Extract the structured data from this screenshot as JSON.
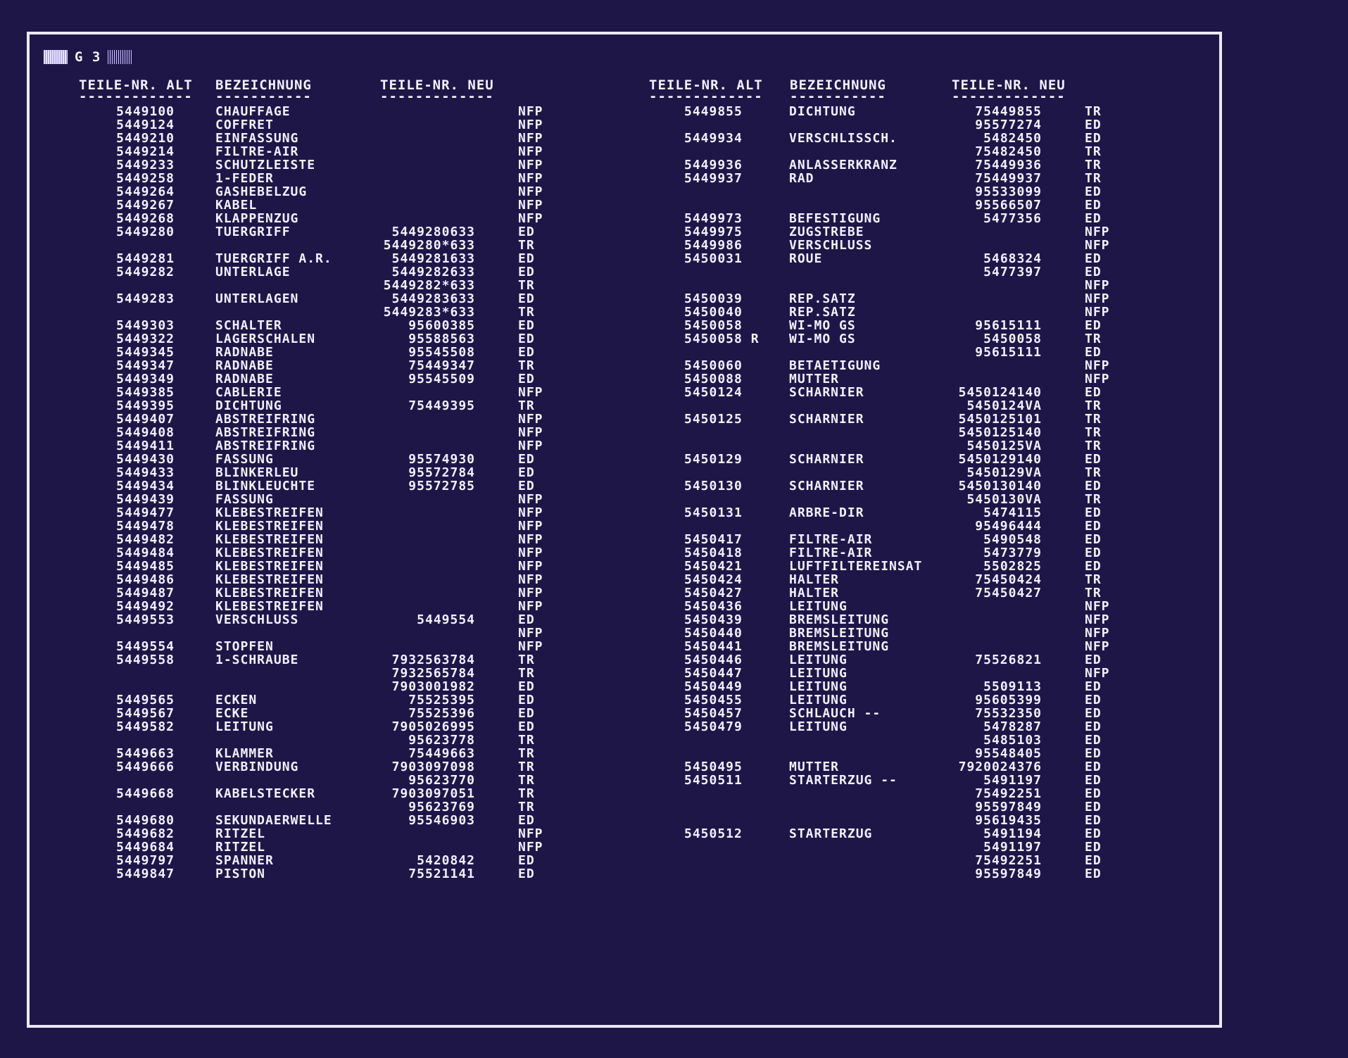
{
  "page": {
    "code": "G 3"
  },
  "headers": {
    "old": "TEILE-NR. ALT",
    "desc": "BEZEICHNUNG",
    "new": "TEILE-NR. NEU",
    "rule_old": "-------------",
    "rule_desc": "-----------",
    "rule_new": "-------------"
  },
  "left_rows": [
    {
      "alt": "5449100",
      "bez": "CHAUFFAGE",
      "neu": "",
      "st": "NFP"
    },
    {
      "alt": "5449124",
      "bez": "COFFRET",
      "neu": "",
      "st": "NFP"
    },
    {
      "alt": "5449210",
      "bez": "EINFASSUNG",
      "neu": "",
      "st": "NFP"
    },
    {
      "alt": "5449214",
      "bez": "FILTRE-AIR",
      "neu": "",
      "st": "NFP"
    },
    {
      "alt": "5449233",
      "bez": "SCHUTZLEISTE",
      "neu": "",
      "st": "NFP"
    },
    {
      "alt": "5449258",
      "bez": "1-FEDER",
      "neu": "",
      "st": "NFP"
    },
    {
      "alt": "5449264",
      "bez": "GASHEBELZUG",
      "neu": "",
      "st": "NFP"
    },
    {
      "alt": "5449267",
      "bez": "KABEL",
      "neu": "",
      "st": "NFP"
    },
    {
      "alt": "5449268",
      "bez": "KLAPPENZUG",
      "neu": "",
      "st": "NFP"
    },
    {
      "alt": "5449280",
      "bez": "TUERGRIFF",
      "neu": "5449280633",
      "st": "ED"
    },
    {
      "alt": "",
      "bez": "",
      "neu": "5449280*633",
      "st": "TR"
    },
    {
      "alt": "5449281",
      "bez": "TUERGRIFF A.R.",
      "neu": "5449281633",
      "st": "ED"
    },
    {
      "alt": "5449282",
      "bez": "UNTERLAGE",
      "neu": "5449282633",
      "st": "ED"
    },
    {
      "alt": "",
      "bez": "",
      "neu": "5449282*633",
      "st": "TR"
    },
    {
      "alt": "5449283",
      "bez": "UNTERLAGEN",
      "neu": "5449283633",
      "st": "ED"
    },
    {
      "alt": "",
      "bez": "",
      "neu": "5449283*633",
      "st": "TR"
    },
    {
      "alt": "5449303",
      "bez": "SCHALTER",
      "neu": "95600385",
      "st": "ED"
    },
    {
      "alt": "5449322",
      "bez": "LAGERSCHALEN",
      "neu": "95588563",
      "st": "ED"
    },
    {
      "alt": "5449345",
      "bez": "RADNABE",
      "neu": "95545508",
      "st": "ED"
    },
    {
      "alt": "5449347",
      "bez": "RADNABE",
      "neu": "75449347",
      "st": "TR"
    },
    {
      "alt": "5449349",
      "bez": "RADNABE",
      "neu": "95545509",
      "st": "ED"
    },
    {
      "alt": "5449385",
      "bez": "CABLERIE",
      "neu": "",
      "st": "NFP"
    },
    {
      "alt": "5449395",
      "bez": "DICHTUNG",
      "neu": "75449395",
      "st": "TR"
    },
    {
      "alt": "5449407",
      "bez": "ABSTREIFRING",
      "neu": "",
      "st": "NFP"
    },
    {
      "alt": "5449408",
      "bez": "ABSTREIFRING",
      "neu": "",
      "st": "NFP"
    },
    {
      "alt": "5449411",
      "bez": "ABSTREIFRING",
      "neu": "",
      "st": "NFP"
    },
    {
      "alt": "5449430",
      "bez": "FASSUNG",
      "neu": "95574930",
      "st": "ED"
    },
    {
      "alt": "5449433",
      "bez": "BLINKERLEU",
      "neu": "95572784",
      "st": "ED"
    },
    {
      "alt": "5449434",
      "bez": "BLINKLEUCHTE",
      "neu": "95572785",
      "st": "ED"
    },
    {
      "alt": "5449439",
      "bez": "FASSUNG",
      "neu": "",
      "st": "NFP"
    },
    {
      "alt": "5449477",
      "bez": "KLEBESTREIFEN",
      "neu": "",
      "st": "NFP"
    },
    {
      "alt": "5449478",
      "bez": "KLEBESTREIFEN",
      "neu": "",
      "st": "NFP"
    },
    {
      "alt": "5449482",
      "bez": "KLEBESTREIFEN",
      "neu": "",
      "st": "NFP"
    },
    {
      "alt": "5449484",
      "bez": "KLEBESTREIFEN",
      "neu": "",
      "st": "NFP"
    },
    {
      "alt": "5449485",
      "bez": "KLEBESTREIFEN",
      "neu": "",
      "st": "NFP"
    },
    {
      "alt": "5449486",
      "bez": "KLEBESTREIFEN",
      "neu": "",
      "st": "NFP"
    },
    {
      "alt": "5449487",
      "bez": "KLEBESTREIFEN",
      "neu": "",
      "st": "NFP"
    },
    {
      "alt": "5449492",
      "bez": "KLEBESTREIFEN",
      "neu": "",
      "st": "NFP"
    },
    {
      "alt": "5449553",
      "bez": "VERSCHLUSS",
      "neu": "5449554",
      "st": "ED"
    },
    {
      "alt": "",
      "bez": "",
      "neu": "",
      "st": "NFP"
    },
    {
      "alt": "5449554",
      "bez": "STOPFEN",
      "neu": "",
      "st": "NFP"
    },
    {
      "alt": "5449558",
      "bez": "1-SCHRAUBE",
      "neu": "7932563784",
      "st": "TR"
    },
    {
      "alt": "",
      "bez": "",
      "neu": "7932565784",
      "st": "TR"
    },
    {
      "alt": "",
      "bez": "",
      "neu": "7903001982",
      "st": "ED"
    },
    {
      "alt": "5449565",
      "bez": "ECKEN",
      "neu": "75525395",
      "st": "ED"
    },
    {
      "alt": "5449567",
      "bez": "ECKE",
      "neu": "75525396",
      "st": "ED"
    },
    {
      "alt": "5449582",
      "bez": "LEITUNG",
      "neu": "7905026995",
      "st": "ED"
    },
    {
      "alt": "",
      "bez": "",
      "neu": "95623778",
      "st": "TR"
    },
    {
      "alt": "5449663",
      "bez": "KLAMMER",
      "neu": "75449663",
      "st": "TR"
    },
    {
      "alt": "5449666",
      "bez": "VERBINDUNG",
      "neu": "7903097098",
      "st": "TR"
    },
    {
      "alt": "",
      "bez": "",
      "neu": "95623770",
      "st": "TR"
    },
    {
      "alt": "5449668",
      "bez": "KABELSTECKER",
      "neu": "7903097051",
      "st": "TR"
    },
    {
      "alt": "",
      "bez": "",
      "neu": "95623769",
      "st": "TR"
    },
    {
      "alt": "5449680",
      "bez": "SEKUNDAERWELLE",
      "neu": "95546903",
      "st": "ED"
    },
    {
      "alt": "5449682",
      "bez": "RITZEL",
      "neu": "",
      "st": "NFP"
    },
    {
      "alt": "5449684",
      "bez": "RITZEL",
      "neu": "",
      "st": "NFP"
    },
    {
      "alt": "5449797",
      "bez": "SPANNER",
      "neu": "5420842",
      "st": "ED"
    },
    {
      "alt": "5449847",
      "bez": "PISTON",
      "neu": "75521141",
      "st": "ED"
    }
  ],
  "right_rows": [
    {
      "alt": "5449855",
      "bez": "DICHTUNG",
      "neu": "75449855",
      "st": "TR"
    },
    {
      "alt": "",
      "bez": "",
      "neu": "95577274",
      "st": "ED"
    },
    {
      "alt": "5449934",
      "bez": "VERSCHLISSCH.",
      "neu": "5482450",
      "st": "ED"
    },
    {
      "alt": "",
      "bez": "",
      "neu": "75482450",
      "st": "TR"
    },
    {
      "alt": "5449936",
      "bez": "ANLASSERKRANZ",
      "neu": "75449936",
      "st": "TR"
    },
    {
      "alt": "5449937",
      "bez": "RAD",
      "neu": "75449937",
      "st": "TR"
    },
    {
      "alt": "",
      "bez": "",
      "neu": "95533099",
      "st": "ED"
    },
    {
      "alt": "",
      "bez": "",
      "neu": "95566507",
      "st": "ED"
    },
    {
      "alt": "5449973",
      "bez": "BEFESTIGUNG",
      "neu": "5477356",
      "st": "ED"
    },
    {
      "alt": "5449975",
      "bez": "ZUGSTREBE",
      "neu": "",
      "st": "NFP"
    },
    {
      "alt": "5449986",
      "bez": "VERSCHLUSS",
      "neu": "",
      "st": "NFP"
    },
    {
      "alt": "5450031",
      "bez": "ROUE",
      "neu": "5468324",
      "st": "ED"
    },
    {
      "alt": "",
      "bez": "",
      "neu": "5477397",
      "st": "ED"
    },
    {
      "alt": "",
      "bez": "",
      "neu": "",
      "st": "NFP"
    },
    {
      "alt": "5450039",
      "bez": "REP.SATZ",
      "neu": "",
      "st": "NFP"
    },
    {
      "alt": "5450040",
      "bez": "REP.SATZ",
      "neu": "",
      "st": "NFP"
    },
    {
      "alt": "5450058",
      "bez": "WI-MO GS",
      "neu": "95615111",
      "st": "ED"
    },
    {
      "alt": "5450058 R",
      "bez": "WI-MO GS",
      "neu": "5450058",
      "st": "TR"
    },
    {
      "alt": "",
      "bez": "",
      "neu": "95615111",
      "st": "ED"
    },
    {
      "alt": "5450060",
      "bez": "BETAETIGUNG",
      "neu": "",
      "st": "NFP"
    },
    {
      "alt": "5450088",
      "bez": "MUTTER",
      "neu": "",
      "st": "NFP"
    },
    {
      "alt": "5450124",
      "bez": "SCHARNIER",
      "neu": "5450124140",
      "st": "ED"
    },
    {
      "alt": "",
      "bez": "",
      "neu": "5450124VA",
      "st": "TR"
    },
    {
      "alt": "5450125",
      "bez": "SCHARNIER",
      "neu": "5450125101",
      "st": "TR"
    },
    {
      "alt": "",
      "bez": "",
      "neu": "5450125140",
      "st": "TR"
    },
    {
      "alt": "",
      "bez": "",
      "neu": "5450125VA",
      "st": "TR"
    },
    {
      "alt": "5450129",
      "bez": "SCHARNIER",
      "neu": "5450129140",
      "st": "ED"
    },
    {
      "alt": "",
      "bez": "",
      "neu": "5450129VA",
      "st": "TR"
    },
    {
      "alt": "5450130",
      "bez": "SCHARNIER",
      "neu": "5450130140",
      "st": "ED"
    },
    {
      "alt": "",
      "bez": "",
      "neu": "5450130VA",
      "st": "TR"
    },
    {
      "alt": "5450131",
      "bez": "ARBRE-DIR",
      "neu": "5474115",
      "st": "ED"
    },
    {
      "alt": "",
      "bez": "",
      "neu": "95496444",
      "st": "ED"
    },
    {
      "alt": "5450417",
      "bez": "FILTRE-AIR",
      "neu": "5490548",
      "st": "ED"
    },
    {
      "alt": "5450418",
      "bez": "FILTRE-AIR",
      "neu": "5473779",
      "st": "ED"
    },
    {
      "alt": "5450421",
      "bez": "LUFTFILTEREINSAT",
      "neu": "5502825",
      "st": "ED"
    },
    {
      "alt": "5450424",
      "bez": "HALTER",
      "neu": "75450424",
      "st": "TR"
    },
    {
      "alt": "5450427",
      "bez": "HALTER",
      "neu": "75450427",
      "st": "TR"
    },
    {
      "alt": "5450436",
      "bez": "LEITUNG",
      "neu": "",
      "st": "NFP"
    },
    {
      "alt": "5450439",
      "bez": "BREMSLEITUNG",
      "neu": "",
      "st": "NFP"
    },
    {
      "alt": "5450440",
      "bez": "BREMSLEITUNG",
      "neu": "",
      "st": "NFP"
    },
    {
      "alt": "5450441",
      "bez": "BREMSLEITUNG",
      "neu": "",
      "st": "NFP"
    },
    {
      "alt": "5450446",
      "bez": "LEITUNG",
      "neu": "75526821",
      "st": "ED"
    },
    {
      "alt": "5450447",
      "bez": "LEITUNG",
      "neu": "",
      "st": "NFP"
    },
    {
      "alt": "5450449",
      "bez": "LEITUNG",
      "neu": "5509113",
      "st": "ED"
    },
    {
      "alt": "5450455",
      "bez": "LEITUNG",
      "neu": "95605399",
      "st": "ED"
    },
    {
      "alt": "5450457",
      "bez": "SCHLAUCH      --",
      "neu": "75532350",
      "st": "ED"
    },
    {
      "alt": "5450479",
      "bez": "LEITUNG",
      "neu": "5478287",
      "st": "ED"
    },
    {
      "alt": "",
      "bez": "",
      "neu": "5485103",
      "st": "ED"
    },
    {
      "alt": "",
      "bez": "",
      "neu": "95548405",
      "st": "ED"
    },
    {
      "alt": "5450495",
      "bez": "MUTTER",
      "neu": "7920024376",
      "st": "ED"
    },
    {
      "alt": "5450511",
      "bez": "STARTERZUG     --",
      "neu": "5491197",
      "st": "ED"
    },
    {
      "alt": "",
      "bez": "",
      "neu": "75492251",
      "st": "ED"
    },
    {
      "alt": "",
      "bez": "",
      "neu": "95597849",
      "st": "ED"
    },
    {
      "alt": "",
      "bez": "",
      "neu": "95619435",
      "st": "ED"
    },
    {
      "alt": "5450512",
      "bez": "STARTERZUG",
      "neu": "5491194",
      "st": "ED"
    },
    {
      "alt": "",
      "bez": "",
      "neu": "5491197",
      "st": "ED"
    },
    {
      "alt": "",
      "bez": "",
      "neu": "75492251",
      "st": "ED"
    },
    {
      "alt": "",
      "bez": "",
      "neu": "95597849",
      "st": "ED"
    }
  ]
}
